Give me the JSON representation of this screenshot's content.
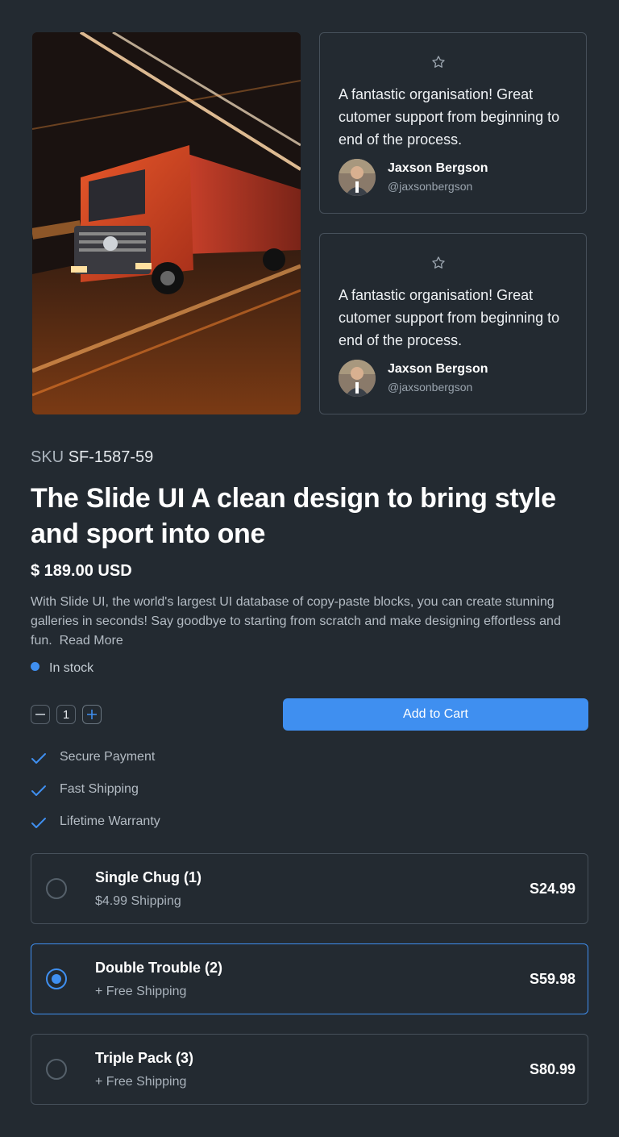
{
  "reviews": [
    {
      "quote": "A fantastic organisation! Great cutomer support from beginning to end of the process.",
      "author": "Jaxson Bergson",
      "handle": "@jaxsonbergson"
    },
    {
      "quote": "A fantastic organisation! Great cutomer support from beginning to end of the process.",
      "author": "Jaxson Bergson",
      "handle": "@jaxsonbergson"
    }
  ],
  "product": {
    "sku_label": "SKU",
    "sku": "SF-1587-59",
    "title": "The Slide UI A clean design to bring style and sport into one",
    "price": "$ 189.00 USD",
    "description": "With Slide UI, the world's largest UI database of copy-paste blocks, you can create stunning galleries in seconds! Say goodbye to starting from scratch and make designing effortless and fun.",
    "read_more": "Read More",
    "stock": "In stock",
    "quantity": "1",
    "add_to_cart": "Add to Cart"
  },
  "features": [
    "Secure Payment",
    "Fast Shipping",
    "Lifetime Warranty"
  ],
  "options": [
    {
      "name": "Single Chug (1)",
      "shipping": "$4.99 Shipping",
      "price": "S24.99",
      "selected": false
    },
    {
      "name": "Double Trouble (2)",
      "shipping": "+ Free Shipping",
      "price": "S59.98",
      "selected": true
    },
    {
      "name": "Triple Pack (3)",
      "shipping": "+ Free Shipping",
      "price": "S80.99",
      "selected": false
    }
  ],
  "colors": {
    "background": "#232a31",
    "accent": "#3f8ff0",
    "border": "#46505a",
    "muted_text": "#b4bcc4"
  },
  "icons": {
    "review_rating": "star-outline-icon",
    "feature": "checkmark-icon",
    "qty_minus": "minus-icon",
    "qty_plus": "plus-icon"
  }
}
